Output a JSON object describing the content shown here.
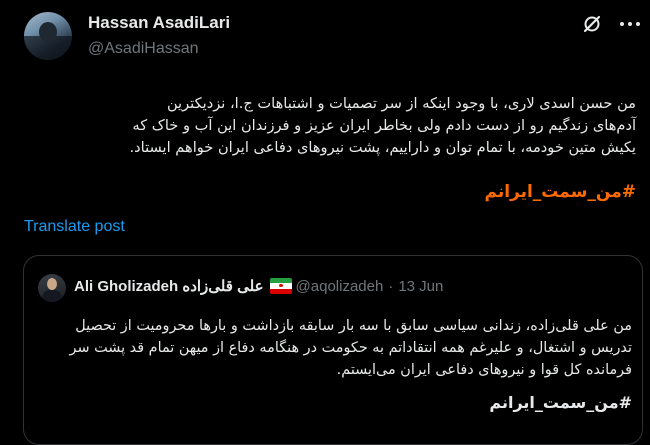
{
  "author": {
    "display_name": "Hassan AsadiLari",
    "handle": "@AsadiHassan"
  },
  "header_actions": {
    "grok_icon": "grok-icon",
    "more_icon": "more-horizontal-icon"
  },
  "post": {
    "lines": [
      "من حسن اسدی لاری، با وجود اینکه از سر تصمیات و اشتباهات ج.ا، نزدیکترین",
      "آدم‌های زندگیم رو از دست دادم ولی بخاطر ایران عزیز و فرزندان این آب و خاک که",
      "یکیش متین خودمه، با تمام توان و داراییم، پشت نیروهای دفاعی ایران خواهم ایستاد."
    ],
    "hashtag": "#من_سمت_ایرانم",
    "translate_label": "Translate post"
  },
  "quote": {
    "display_name": "Ali Gholizadeh علی قلی‌زاده",
    "flag_icon": "iran-flag-icon",
    "handle": "@aqolizadeh",
    "separator": "·",
    "date": "13 Jun",
    "lines": [
      "من علی قلی‌زاده، زندانی سیاسی سابق با سه بار سابقه بازداشت و بارها محرومیت از تحصیل",
      "تدریس و اشتغال، و علیرغم همه انتقاداتم به حکومت در هنگامه دفاع از میهن تمام قد پشت سر",
      "فرمانده کل قوا و نیروهای دفاعی ایران می‌ایستم."
    ],
    "hashtag": "#من_سمت_ایرانم"
  },
  "colors": {
    "background": "#000000",
    "text": "#e7e9ea",
    "muted": "#71767b",
    "link": "#1d9bf0",
    "hashtag_orange": "#ff6a00",
    "border": "#2f3336"
  }
}
